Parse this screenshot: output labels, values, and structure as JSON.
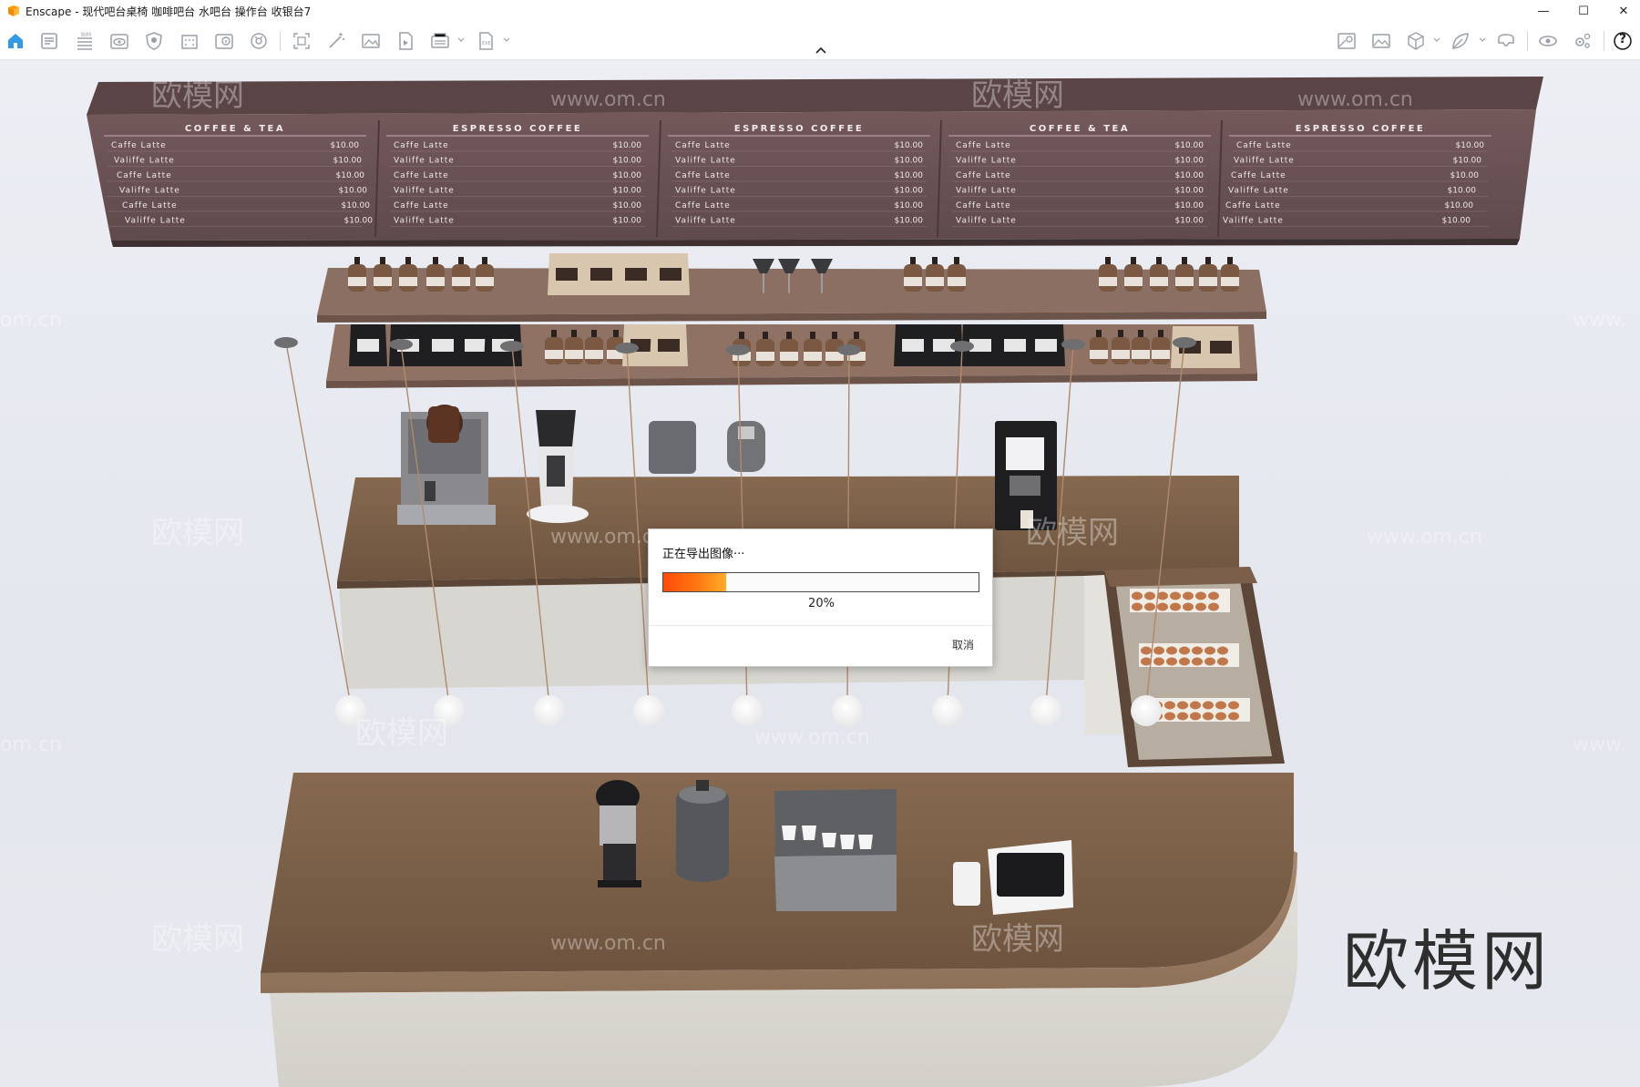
{
  "window": {
    "title": "Enscape - 现代吧台桌椅 咖啡吧台 水吧台 操作台 收银台7",
    "minimize": "—",
    "maximize": "☐",
    "close": "✕"
  },
  "toolbar": {
    "left_icons": [
      "home-icon",
      "document-icon",
      "bim-icon",
      "eye-icon",
      "shield-icon",
      "building-icon",
      "info-panel-icon",
      "palette-icon",
      "screenshot-icon",
      "magic-wand-icon",
      "image-icon",
      "video-icon",
      "batch-render-icon",
      "export-icon"
    ],
    "right_icons": [
      "map-icon",
      "landscape-icon",
      "cube-icon",
      "leaf-icon",
      "vr-headset-icon",
      "preview-eye-icon",
      "settings-icon",
      "help-icon"
    ],
    "help_label": "?"
  },
  "menu_board": {
    "columns": [
      {
        "heading": "COFFEE & TEA",
        "items": [
          [
            "Caffe Latte",
            "$10.00"
          ],
          [
            "Valiffe Latte",
            "$10.00"
          ],
          [
            "Caffe Latte",
            "$10.00"
          ],
          [
            "Valiffe Latte",
            "$10.00"
          ],
          [
            "Caffe Latte",
            "$10.00"
          ],
          [
            "Valiffe Latte",
            "$10.00"
          ]
        ]
      },
      {
        "heading": "ESPRESSO COFFEE",
        "items": [
          [
            "Caffe Latte",
            "$10.00"
          ],
          [
            "Valiffe Latte",
            "$10.00"
          ],
          [
            "Caffe Latte",
            "$10.00"
          ],
          [
            "Valiffe Latte",
            "$10.00"
          ],
          [
            "Caffe Latte",
            "$10.00"
          ],
          [
            "Valiffe Latte",
            "$10.00"
          ]
        ]
      },
      {
        "heading": "ESPRESSO COFFEE",
        "items": [
          [
            "Caffe Latte",
            "$10.00"
          ],
          [
            "Valiffe Latte",
            "$10.00"
          ],
          [
            "Caffe Latte",
            "$10.00"
          ],
          [
            "Valiffe Latte",
            "$10.00"
          ],
          [
            "Caffe Latte",
            "$10.00"
          ],
          [
            "Valiffe Latte",
            "$10.00"
          ]
        ]
      },
      {
        "heading": "COFFEE & TEA",
        "items": [
          [
            "Caffe Latte",
            "$10.00"
          ],
          [
            "Valiffe Latte",
            "$10.00"
          ],
          [
            "Caffe Latte",
            "$10.00"
          ],
          [
            "Valiffe Latte",
            "$10.00"
          ],
          [
            "Caffe Latte",
            "$10.00"
          ],
          [
            "Valiffe Latte",
            "$10.00"
          ]
        ]
      },
      {
        "heading": "ESPRESSO COFFEE",
        "items": [
          [
            "Caffe Latte",
            "$10.00"
          ],
          [
            "Valiffe Latte",
            "$10.00"
          ],
          [
            "Caffe Latte",
            "$10.00"
          ],
          [
            "Valiffe Latte",
            "$10.00"
          ],
          [
            "Caffe Latte",
            "$10.00"
          ],
          [
            "Valiffe Latte",
            "$10.00"
          ]
        ]
      }
    ]
  },
  "watermarks": {
    "logo_text": "欧模网",
    "url_text": "www.om.cn",
    "url_partial_left": "om.cn",
    "url_partial_right": "www."
  },
  "brand_logo": "欧模网",
  "export_dialog": {
    "message": "正在导出图像···",
    "progress": 0.2,
    "progress_label": "20%",
    "cancel_label": "取消"
  },
  "colors": {
    "accent": "#2f9be8",
    "progress_start": "#ff4a0a",
    "progress_end": "#ffab2a",
    "menu_board": "#6b5658",
    "wood": "#7a5e4c"
  }
}
